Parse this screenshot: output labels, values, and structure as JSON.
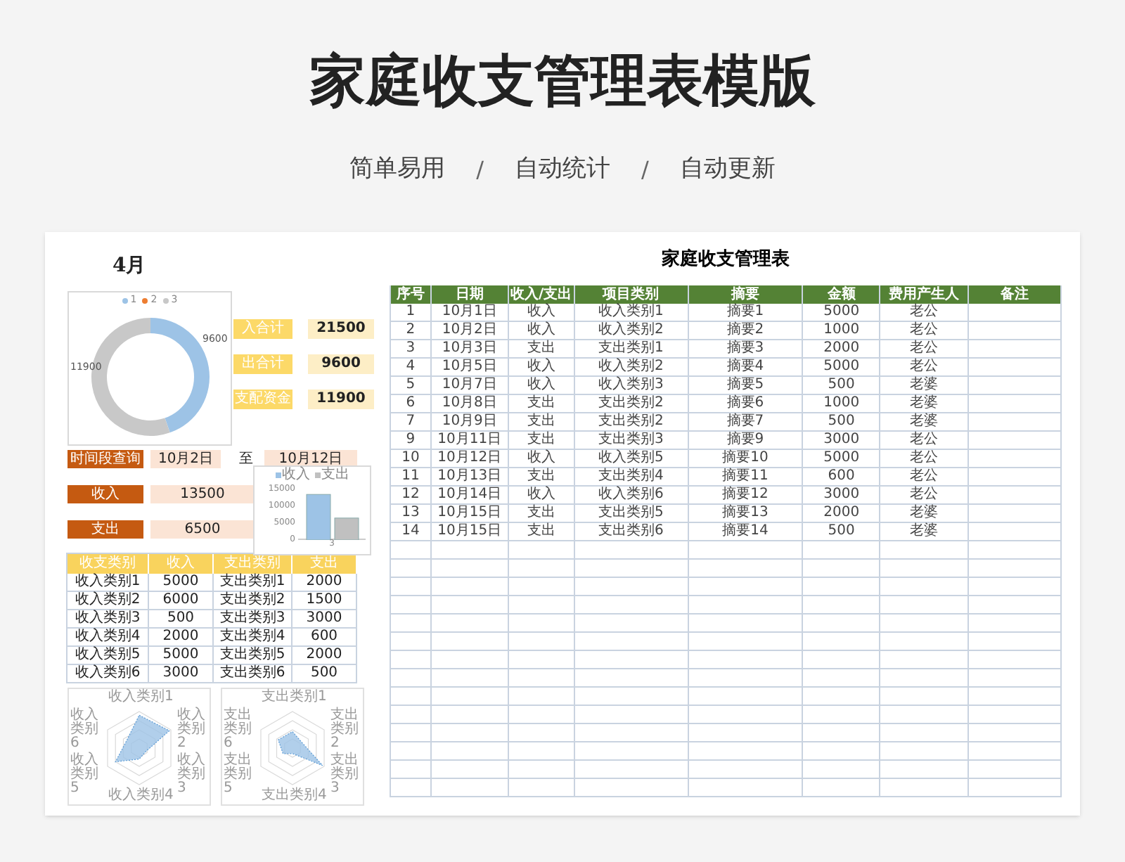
{
  "header": {
    "title": "家庭收支管理表模版",
    "tags": [
      "简单易用",
      "自动统计",
      "自动更新"
    ],
    "separators": [
      "/",
      "/"
    ]
  },
  "dashboard": {
    "month": "4月",
    "summary": [
      {
        "label": "入合计",
        "value": "21500"
      },
      {
        "label": "出合计",
        "value": "9600"
      },
      {
        "label": "支配资金",
        "value": "11900"
      }
    ],
    "donut": {
      "chart_data": {
        "type": "donut",
        "categories": [
          "1",
          "2",
          "3"
        ],
        "values": [
          9600,
          0,
          11900
        ],
        "value_labels": [
          "9600",
          null,
          "11900"
        ],
        "legend": "top"
      }
    },
    "query": {
      "label": "时间段查询",
      "from": "10月2日",
      "to_label": "至",
      "to": "10月12日"
    },
    "totals": [
      {
        "label": "收入",
        "value": "13500"
      },
      {
        "label": "支出",
        "value": "6500"
      }
    ],
    "bar": {
      "chart_data": {
        "type": "bar",
        "categories": [
          "3"
        ],
        "series": [
          {
            "name": "收入",
            "color": "#9dc3e6",
            "values": [
              13500
            ]
          },
          {
            "name": "支出",
            "color": "#c0c0c0",
            "values": [
              6500
            ]
          }
        ],
        "ylim": [
          0,
          15000
        ],
        "yticks": [
          0,
          5000,
          10000,
          15000
        ],
        "legend": "top"
      }
    },
    "category_table": {
      "columns": [
        "收支类别",
        "收入",
        "支出类别",
        "支出"
      ],
      "rows": [
        [
          "收入类别1",
          "5000",
          "支出类别1",
          "2000"
        ],
        [
          "收入类别2",
          "6000",
          "支出类别2",
          "1500"
        ],
        [
          "收入类别3",
          "500",
          "支出类别3",
          "3000"
        ],
        [
          "收入类别4",
          "2000",
          "支出类别4",
          "600"
        ],
        [
          "收入类别5",
          "5000",
          "支出类别5",
          "2000"
        ],
        [
          "收入类别6",
          "3000",
          "支出类别6",
          "500"
        ]
      ]
    },
    "radars": [
      {
        "labels": [
          "收入类别1",
          "收入类别2",
          "收入类别3",
          "收入类别4",
          "收入类别5",
          "收入类别6"
        ]
      },
      {
        "labels": [
          "支出类别1",
          "支出类别2",
          "支出类别3",
          "支出类别4",
          "支出类别5",
          "支出类别6"
        ]
      }
    ]
  },
  "ledger": {
    "title": "家庭收支管理表",
    "columns": [
      "序号",
      "日期",
      "收入/支出",
      "项目类别",
      "摘要",
      "金额",
      "费用产生人",
      "备注"
    ],
    "rows": [
      [
        "1",
        "10月1日",
        "收入",
        "收入类别1",
        "摘要1",
        "5000",
        "老公"
      ],
      [
        "2",
        "10月2日",
        "收入",
        "收入类别2",
        "摘要2",
        "1000",
        "老公"
      ],
      [
        "3",
        "10月3日",
        "支出",
        "支出类别1",
        "摘要3",
        "2000",
        "老公"
      ],
      [
        "4",
        "10月5日",
        "收入",
        "收入类别2",
        "摘要4",
        "5000",
        "老公"
      ],
      [
        "5",
        "10月7日",
        "收入",
        "收入类别3",
        "摘要5",
        "500",
        "老婆"
      ],
      [
        "6",
        "10月8日",
        "支出",
        "支出类别2",
        "摘要6",
        "1000",
        "老婆"
      ],
      [
        "7",
        "10月9日",
        "支出",
        "支出类别2",
        "摘要7",
        "500",
        "老婆"
      ],
      [
        "9",
        "10月11日",
        "支出",
        "支出类别3",
        "摘要9",
        "3000",
        "老公"
      ],
      [
        "10",
        "10月12日",
        "收入",
        "收入类别5",
        "摘要10",
        "5000",
        "老公"
      ],
      [
        "11",
        "10月13日",
        "支出",
        "支出类别4",
        "摘要11",
        "600",
        "老公"
      ],
      [
        "12",
        "10月14日",
        "收入",
        "收入类别6",
        "摘要12",
        "3000",
        "老公"
      ],
      [
        "13",
        "10月15日",
        "支出",
        "支出类别5",
        "摘要13",
        "2000",
        "老婆"
      ],
      [
        "14",
        "10月15日",
        "支出",
        "支出类别6",
        "摘要14",
        "500",
        "老婆"
      ]
    ]
  }
}
